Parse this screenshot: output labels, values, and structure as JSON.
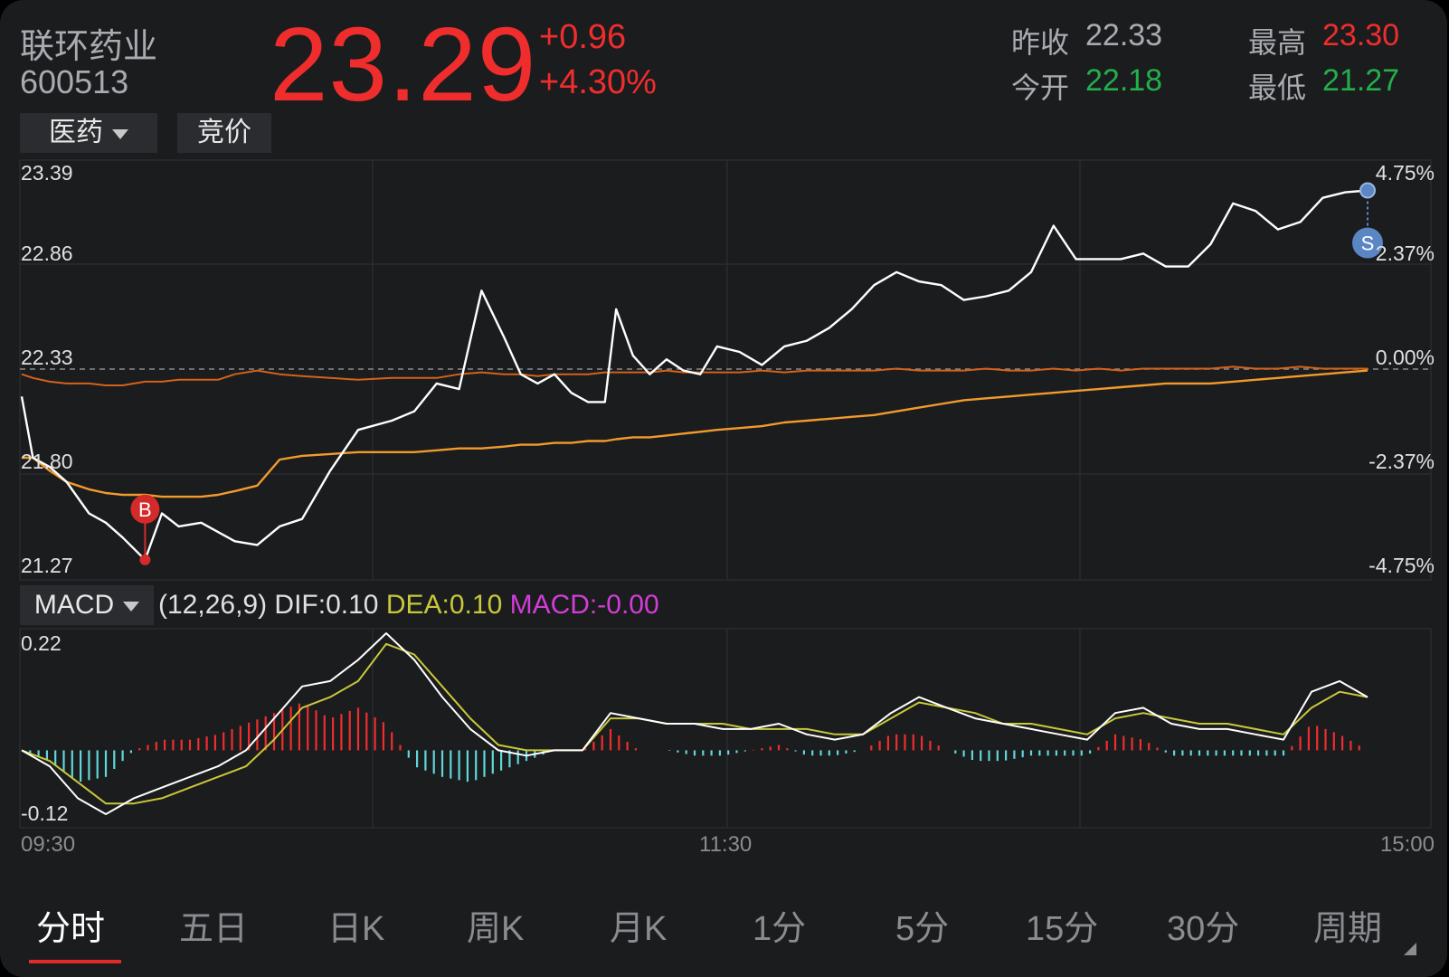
{
  "header": {
    "name": "联环药业",
    "code": "600513",
    "price": "23.29",
    "change": "+0.96",
    "change_pct": "+4.30%",
    "prev_close_label": "昨收",
    "prev_close": "22.33",
    "open_label": "今开",
    "open": "22.18",
    "high_label": "最高",
    "high": "23.30",
    "low_label": "最低",
    "low": "21.27"
  },
  "buttons": {
    "sector": "医药",
    "auction": "竞价"
  },
  "indicator": {
    "name": "MACD",
    "params": "(12,26,9)",
    "dif_label": "DIF:",
    "dif": "0.10",
    "dea_label": "DEA:",
    "dea": "0.10",
    "macd_label": "MACD:",
    "macd": "-0.00"
  },
  "markers": {
    "buy": "B",
    "sell": "S"
  },
  "tabs": [
    "分时",
    "五日",
    "日K",
    "周K",
    "月K",
    "1分",
    "5分",
    "15分",
    "30分",
    "周期"
  ],
  "colors": {
    "up": "#f02d2d",
    "down": "#22b04a",
    "price_line": "#ffffff",
    "avg_line": "#f39a2c",
    "sector_line": "#d4621a",
    "dea": "#c8c83a",
    "macd_text": "#d23dd8",
    "macd_neg": "#5fd7d9"
  },
  "chart_data": [
    {
      "type": "line",
      "title": "",
      "x_ticks": [
        "09:30",
        "11:30",
        "15:00"
      ],
      "y_left_ticks": [
        "23.39",
        "22.86",
        "22.33",
        "21.80",
        "21.27"
      ],
      "y_right_ticks": [
        "4.75%",
        "2.37%",
        "0.00%",
        "-2.37%",
        "-4.75%"
      ],
      "ylim": [
        21.27,
        23.39
      ],
      "reference_price": 22.33,
      "x": [
        0,
        2,
        5,
        8,
        12,
        15,
        18,
        22,
        25,
        28,
        32,
        35,
        38,
        42,
        46,
        50,
        55,
        60,
        66,
        70,
        74,
        78,
        82,
        86,
        89,
        92,
        95,
        98,
        101,
        104,
        106,
        109,
        112,
        115,
        118,
        121,
        124,
        128,
        132,
        136,
        140,
        144,
        148,
        152,
        156,
        160,
        164,
        168,
        172,
        176,
        180,
        184,
        188,
        192,
        196,
        200,
        204,
        208,
        212,
        216,
        220,
        224,
        228,
        232,
        236,
        240
      ],
      "series": [
        {
          "values": [
            22.18,
            21.85,
            21.8,
            21.72,
            21.55,
            21.5,
            21.42,
            21.3,
            21.55,
            21.48,
            21.5,
            21.45,
            21.4,
            21.38,
            21.48,
            21.52,
            21.78,
            22.0,
            22.05,
            22.1,
            22.25,
            22.22,
            22.75,
            22.5,
            22.3,
            22.25,
            22.3,
            22.2,
            22.15,
            22.15,
            22.65,
            22.4,
            22.3,
            22.38,
            22.32,
            22.3,
            22.45,
            22.42,
            22.35,
            22.45,
            22.48,
            22.55,
            22.65,
            22.78,
            22.85,
            22.8,
            22.78,
            22.7,
            22.72,
            22.75,
            22.85,
            23.1,
            22.92,
            22.92,
            22.92,
            22.95,
            22.88,
            22.88,
            23.0,
            23.22,
            23.18,
            23.08,
            23.12,
            23.25,
            23.28,
            23.29
          ]
        },
        {
          "values": [
            21.85,
            21.85,
            21.78,
            21.72,
            21.68,
            21.66,
            21.65,
            21.65,
            21.64,
            21.64,
            21.64,
            21.65,
            21.67,
            21.7,
            21.84,
            21.86,
            21.87,
            21.88,
            21.88,
            21.88,
            21.89,
            21.9,
            21.9,
            21.91,
            21.92,
            21.92,
            21.93,
            21.93,
            21.94,
            21.94,
            21.95,
            21.96,
            21.96,
            21.97,
            21.98,
            21.99,
            22.0,
            22.01,
            22.02,
            22.04,
            22.05,
            22.06,
            22.07,
            22.08,
            22.1,
            22.12,
            22.14,
            22.16,
            22.17,
            22.18,
            22.19,
            22.2,
            22.21,
            22.22,
            22.23,
            22.24,
            22.25,
            22.25,
            22.25,
            22.26,
            22.27,
            22.28,
            22.29,
            22.3,
            22.31,
            22.32
          ]
        },
        {
          "values": [
            22.3,
            22.28,
            22.26,
            22.25,
            22.25,
            22.24,
            22.24,
            22.26,
            22.26,
            22.27,
            22.27,
            22.27,
            22.3,
            22.32,
            22.3,
            22.29,
            22.28,
            22.27,
            22.28,
            22.28,
            22.28,
            22.3,
            22.31,
            22.3,
            22.3,
            22.29,
            22.3,
            22.3,
            22.3,
            22.31,
            22.31,
            22.31,
            22.31,
            22.32,
            22.31,
            22.31,
            22.31,
            22.31,
            22.32,
            22.31,
            22.32,
            22.32,
            22.32,
            22.32,
            22.33,
            22.32,
            22.32,
            22.32,
            22.33,
            22.32,
            22.32,
            22.33,
            22.32,
            22.33,
            22.32,
            22.33,
            22.33,
            22.33,
            22.33,
            22.34,
            22.33,
            22.33,
            22.34,
            22.33,
            22.33,
            22.33
          ]
        }
      ]
    },
    {
      "type": "line",
      "title": "MACD",
      "ylim": [
        -0.12,
        0.22
      ],
      "y_ticks": [
        "0.22",
        "-0.12"
      ],
      "x": [
        0,
        5,
        10,
        15,
        20,
        25,
        30,
        35,
        40,
        45,
        50,
        55,
        60,
        65,
        70,
        75,
        80,
        85,
        90,
        95,
        100,
        105,
        110,
        115,
        120,
        125,
        130,
        135,
        140,
        145,
        150,
        155,
        160,
        165,
        170,
        175,
        180,
        185,
        190,
        195,
        200,
        205,
        210,
        215,
        220,
        225,
        230,
        235,
        240
      ],
      "series": [
        {
          "name": "DIF",
          "values": [
            0.0,
            -0.03,
            -0.09,
            -0.12,
            -0.09,
            -0.07,
            -0.05,
            -0.03,
            0.0,
            0.06,
            0.12,
            0.13,
            0.17,
            0.22,
            0.17,
            0.1,
            0.04,
            0.0,
            -0.01,
            -0.0,
            0.0,
            0.07,
            0.06,
            0.05,
            0.05,
            0.04,
            0.04,
            0.05,
            0.03,
            0.02,
            0.03,
            0.07,
            0.1,
            0.08,
            0.06,
            0.05,
            0.04,
            0.03,
            0.02,
            0.07,
            0.08,
            0.05,
            0.04,
            0.04,
            0.03,
            0.02,
            0.11,
            0.13,
            0.1
          ]
        },
        {
          "name": "DEA",
          "values": [
            0.0,
            -0.02,
            -0.06,
            -0.1,
            -0.1,
            -0.09,
            -0.07,
            -0.05,
            -0.03,
            0.02,
            0.08,
            0.1,
            0.13,
            0.2,
            0.18,
            0.12,
            0.06,
            0.01,
            0.0,
            -0.0,
            0.0,
            0.06,
            0.06,
            0.05,
            0.05,
            0.05,
            0.04,
            0.04,
            0.04,
            0.03,
            0.03,
            0.06,
            0.09,
            0.08,
            0.07,
            0.05,
            0.05,
            0.04,
            0.03,
            0.06,
            0.07,
            0.06,
            0.05,
            0.05,
            0.04,
            0.03,
            0.08,
            0.11,
            0.1
          ]
        },
        {
          "name": "MACD",
          "values": [
            0.0,
            -0.02,
            -0.06,
            -0.05,
            0.0,
            0.02,
            0.02,
            0.03,
            0.05,
            0.07,
            0.09,
            0.06,
            0.08,
            0.05,
            -0.03,
            -0.05,
            -0.06,
            -0.04,
            -0.02,
            0.0,
            0.0,
            0.04,
            0.0,
            0.0,
            -0.01,
            -0.01,
            0.0,
            0.01,
            -0.01,
            -0.01,
            0.0,
            0.03,
            0.03,
            0.0,
            -0.02,
            -0.02,
            -0.01,
            -0.01,
            -0.01,
            0.03,
            0.02,
            -0.01,
            -0.01,
            -0.01,
            -0.01,
            -0.01,
            0.05,
            0.03,
            0.0
          ]
        }
      ]
    }
  ]
}
